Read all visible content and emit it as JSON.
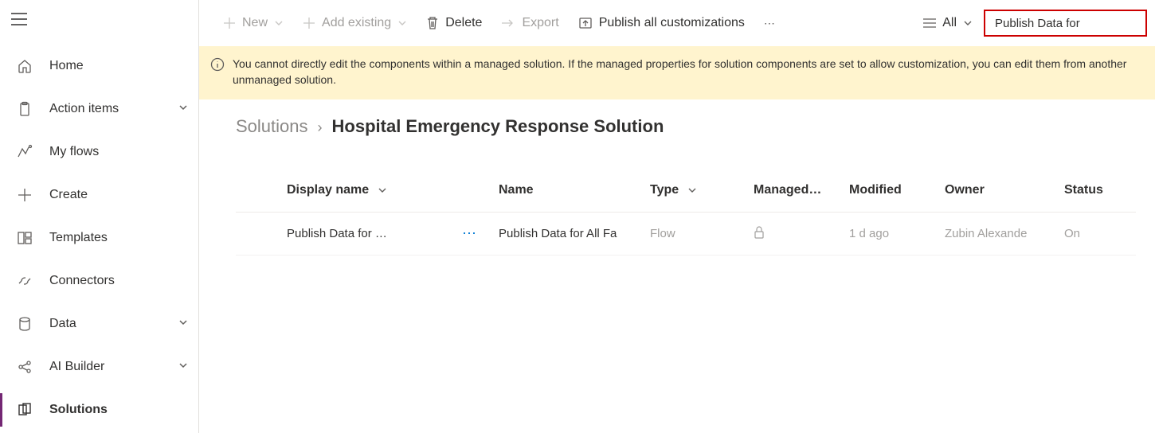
{
  "sidebar": {
    "items": [
      {
        "label": "Home",
        "expandable": false
      },
      {
        "label": "Action items",
        "expandable": true
      },
      {
        "label": "My flows",
        "expandable": false
      },
      {
        "label": "Create",
        "expandable": false
      },
      {
        "label": "Templates",
        "expandable": false
      },
      {
        "label": "Connectors",
        "expandable": false
      },
      {
        "label": "Data",
        "expandable": true
      },
      {
        "label": "AI Builder",
        "expandable": true
      },
      {
        "label": "Solutions",
        "expandable": false,
        "active": true
      }
    ]
  },
  "toolbar": {
    "new_label": "New",
    "add_existing_label": "Add existing",
    "delete_label": "Delete",
    "export_label": "Export",
    "publish_label": "Publish all customizations",
    "filter_label": "All",
    "search_value": "Publish Data for"
  },
  "banner": {
    "text": "You cannot directly edit the components within a managed solution. If the managed properties for solution components are set to allow customization, you can edit them from another unmanaged solution."
  },
  "breadcrumb": {
    "root": "Solutions",
    "title": "Hospital Emergency Response Solution"
  },
  "table": {
    "headers": {
      "display_name": "Display name",
      "name": "Name",
      "type": "Type",
      "managed": "Managed…",
      "modified": "Modified",
      "owner": "Owner",
      "status": "Status"
    },
    "rows": [
      {
        "display_name": "Publish Data for …",
        "name": "Publish Data for All Fa",
        "type": "Flow",
        "managed_icon": "lock",
        "modified": "1 d ago",
        "owner": "Zubin Alexande",
        "status": "On"
      }
    ]
  }
}
